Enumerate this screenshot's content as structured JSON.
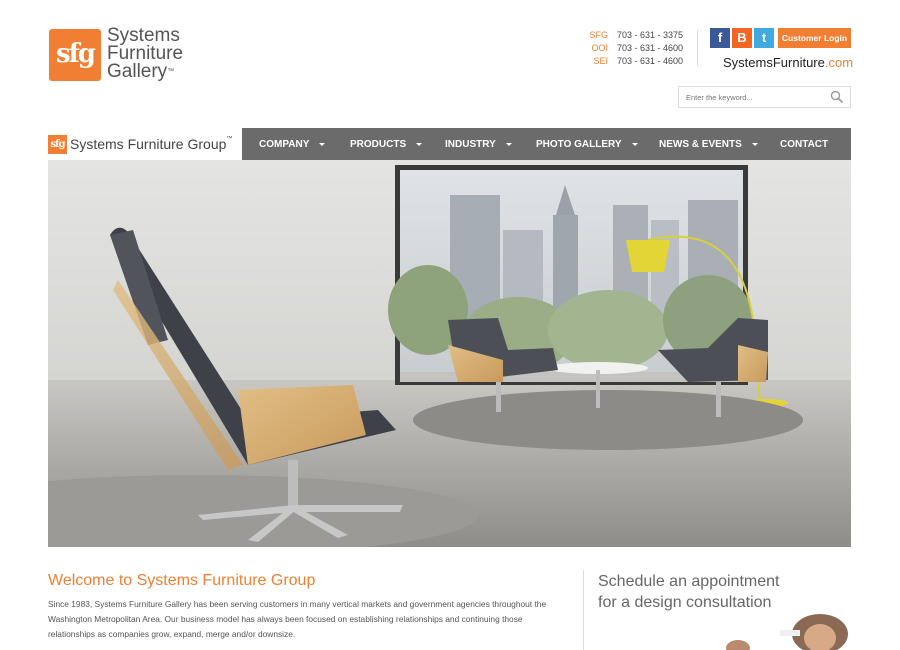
{
  "header": {
    "logo": {
      "mark": "sfg",
      "line1": "Systems",
      "line2": "Furniture",
      "line3": "Gallery",
      "tm": "™"
    },
    "phones": [
      {
        "key": "SFG",
        "number": "703 - 631 - 3375"
      },
      {
        "key": "OOI",
        "number": "703 - 631 - 4600"
      },
      {
        "key": "SEI",
        "number": "703 - 631 - 4600"
      }
    ],
    "social": {
      "facebook": "f",
      "blogger": "B",
      "twitter": "t"
    },
    "login_label": "Customer Login",
    "domain": {
      "name": "SystemsFurniture",
      "tld": ".com"
    },
    "search": {
      "placeholder": "Enter the keyword..."
    }
  },
  "nav": {
    "brand": {
      "mark": "sfg",
      "text": "Systems Furniture Group",
      "tm": "™"
    },
    "items": [
      {
        "label": "COMPANY",
        "dropdown": true
      },
      {
        "label": "PRODUCTS",
        "dropdown": true
      },
      {
        "label": "INDUSTRY",
        "dropdown": true
      },
      {
        "label": "PHOTO GALLERY",
        "dropdown": true
      },
      {
        "label": "NEWS & EVENTS",
        "dropdown": true
      },
      {
        "label": "CONTACT",
        "dropdown": false
      }
    ]
  },
  "welcome": {
    "title": "Welcome to Systems Furniture Group",
    "body": "Since 1983, Systems Furniture Gallery has been serving customers in many vertical markets and government agencies throughout the Washington Metropolitan Area. Our business model has always been focused on establishing relationships and continuing those relationships as companies grow, expand, merge and/or downsize."
  },
  "schedule": {
    "line1": "Schedule an appointment",
    "line2": "for a design consultation"
  },
  "colors": {
    "accent": "#f07f33",
    "nav_bg": "#6b6b6b",
    "facebook": "#3b5998",
    "blogger": "#f26522",
    "twitter": "#3fa9e0"
  },
  "icons": [
    "search-icon",
    "facebook-icon",
    "blogger-icon",
    "twitter-icon",
    "caret-down-icon"
  ]
}
